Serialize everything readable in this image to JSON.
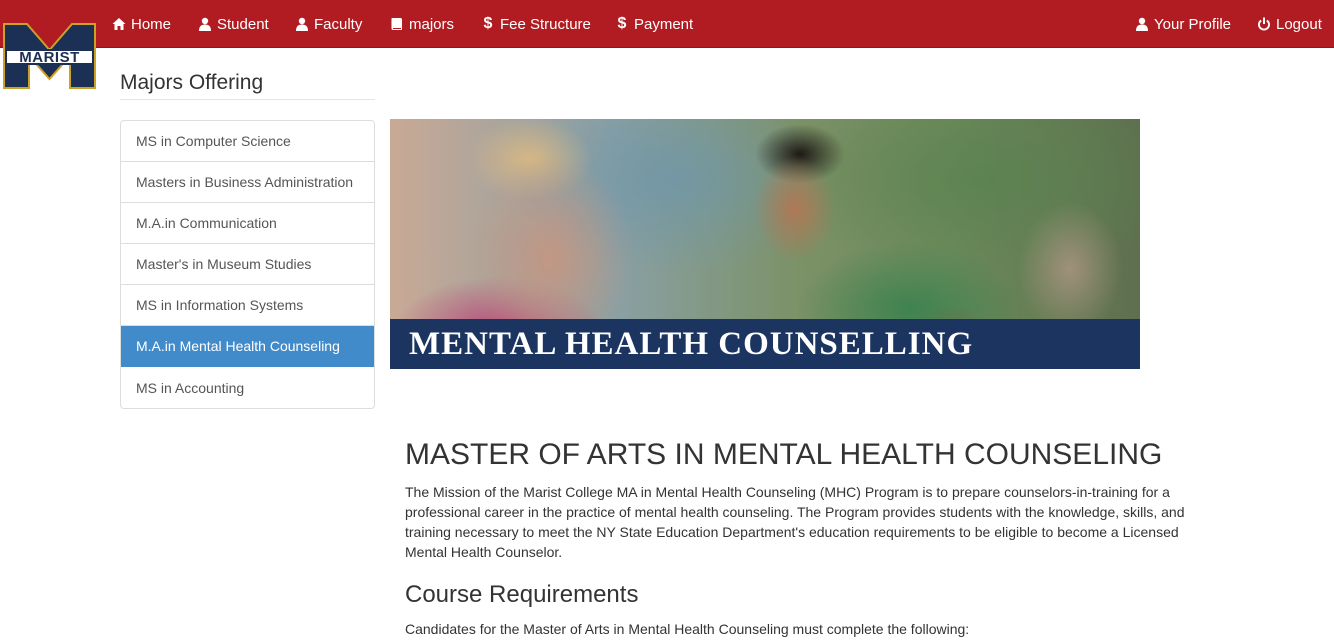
{
  "nav": {
    "home": "Home",
    "student": "Student",
    "faculty": "Faculty",
    "majors": "majors",
    "fee": "Fee Structure",
    "payment": "Payment",
    "profile": "Your Profile",
    "logout": "Logout"
  },
  "logo": {
    "text": "MARIST"
  },
  "sidebar": {
    "title": "Majors Offering",
    "items": [
      {
        "label": "MS in Computer Science",
        "active": false
      },
      {
        "label": "Masters in Business Administration",
        "active": false
      },
      {
        "label": "M.A.in Communication",
        "active": false
      },
      {
        "label": "Master's in Museum Studies",
        "active": false
      },
      {
        "label": "MS in Information Systems",
        "active": false
      },
      {
        "label": "M.A.in Mental Health Counseling",
        "active": true
      },
      {
        "label": "MS in Accounting",
        "active": false
      }
    ]
  },
  "hero": {
    "banner": "MENTAL HEALTH COUNSELLING"
  },
  "content": {
    "heading": "MASTER OF ARTS IN MENTAL HEALTH COUNSELING",
    "mission": "The Mission of the Marist College MA in Mental Health Counseling (MHC) Program is to prepare counselors-in-training for a professional career in the practice of mental health counseling. The Program provides students with the knowledge, skills, and training necessary to meet the NY State Education Department's education requirements to be eligible to become a Licensed Mental Health Counselor.",
    "subheading": "Course Requirements",
    "requirements_intro": "Candidates for the Master of Arts in Mental Health Counseling must complete the following:"
  },
  "colors": {
    "navbar": "#b01c22",
    "active_item": "#428bca",
    "banner": "#1c3560",
    "logo_navy": "#1c2f54",
    "logo_gold": "#c9a227"
  }
}
